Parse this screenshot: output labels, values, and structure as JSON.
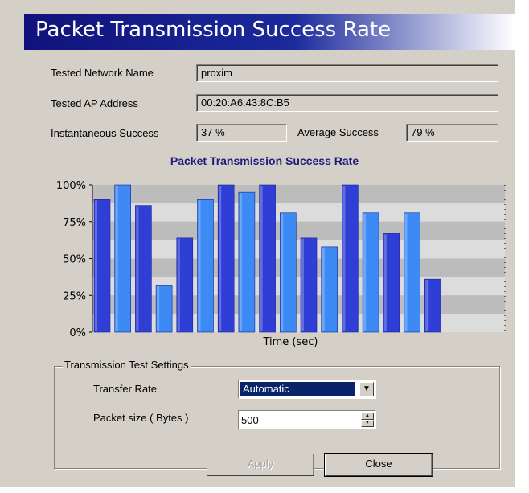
{
  "window": {
    "title": "Packet Transmission Success Rate"
  },
  "fields": {
    "network_name_label": "Tested Network Name",
    "network_name_value": "proxim",
    "ap_address_label": "Tested AP Address",
    "ap_address_value": "00:20:A6:43:8C:B5",
    "instant_label": "Instantaneous Success",
    "instant_value": "37 %",
    "average_label": "Average Success",
    "average_value": "79 %"
  },
  "colors": {
    "bar_dark": "#2f3fd6",
    "bar_light": "#3d8af5",
    "band_dark": "#bcbcbc",
    "band_light": "#dcdcdc",
    "chart_title": "#1c1c7e"
  },
  "chart_data": {
    "type": "bar",
    "title": "Packet Transmission Success Rate",
    "xlabel": "Time (sec)",
    "ylabel": "",
    "ylim": [
      0,
      100
    ],
    "yticks": [
      "0%",
      "25%",
      "50%",
      "75%",
      "100%"
    ],
    "grid": true,
    "values": [
      90,
      100,
      86,
      32,
      64,
      90,
      100,
      95,
      100,
      81,
      64,
      58,
      100,
      81,
      67,
      81,
      36
    ]
  },
  "settings": {
    "group_label": "Transmission Test Settings",
    "transfer_rate_label": "Transfer Rate",
    "transfer_rate_value": "Automatic",
    "packet_size_label": "Packet size  ( Bytes )",
    "packet_size_value": "500"
  },
  "buttons": {
    "apply": "Apply",
    "close": "Close"
  }
}
